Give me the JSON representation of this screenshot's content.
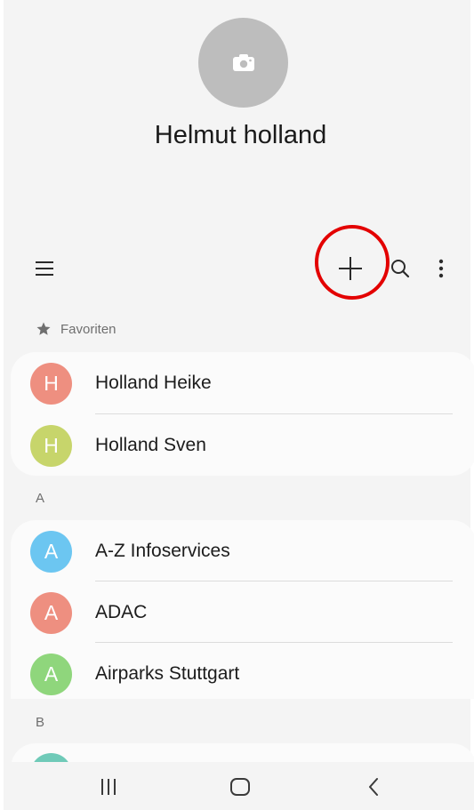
{
  "profile": {
    "name": "Helmut holland",
    "photo_icon": "camera-icon"
  },
  "toolbar": {
    "menu_icon": "menu-icon",
    "add_icon": "plus-icon",
    "search_icon": "search-icon",
    "more_icon": "more-vert-icon"
  },
  "favorites": {
    "label": "Favoriten",
    "contacts": [
      {
        "initial": "H",
        "name": "Holland Heike",
        "color": "#ee8f80"
      },
      {
        "initial": "H",
        "name": "Holland Sven",
        "color": "#c7d56b"
      }
    ]
  },
  "sections": [
    {
      "letter": "A",
      "contacts": [
        {
          "initial": "A",
          "name": "A-Z Infoservices",
          "color": "#6cc6f1"
        },
        {
          "initial": "A",
          "name": "ADAC",
          "color": "#ee8f80"
        },
        {
          "initial": "A",
          "name": "Airparks Stuttgart",
          "color": "#8fd67c"
        }
      ]
    },
    {
      "letter": "B",
      "contacts": [
        {
          "initial": "",
          "name": "",
          "color": "#6fcab8"
        }
      ]
    }
  ],
  "navbar": {
    "recents_icon": "recent-apps-icon",
    "home_icon": "home-icon",
    "back_icon": "back-icon"
  },
  "colors": {
    "highlight": "#e30000"
  }
}
